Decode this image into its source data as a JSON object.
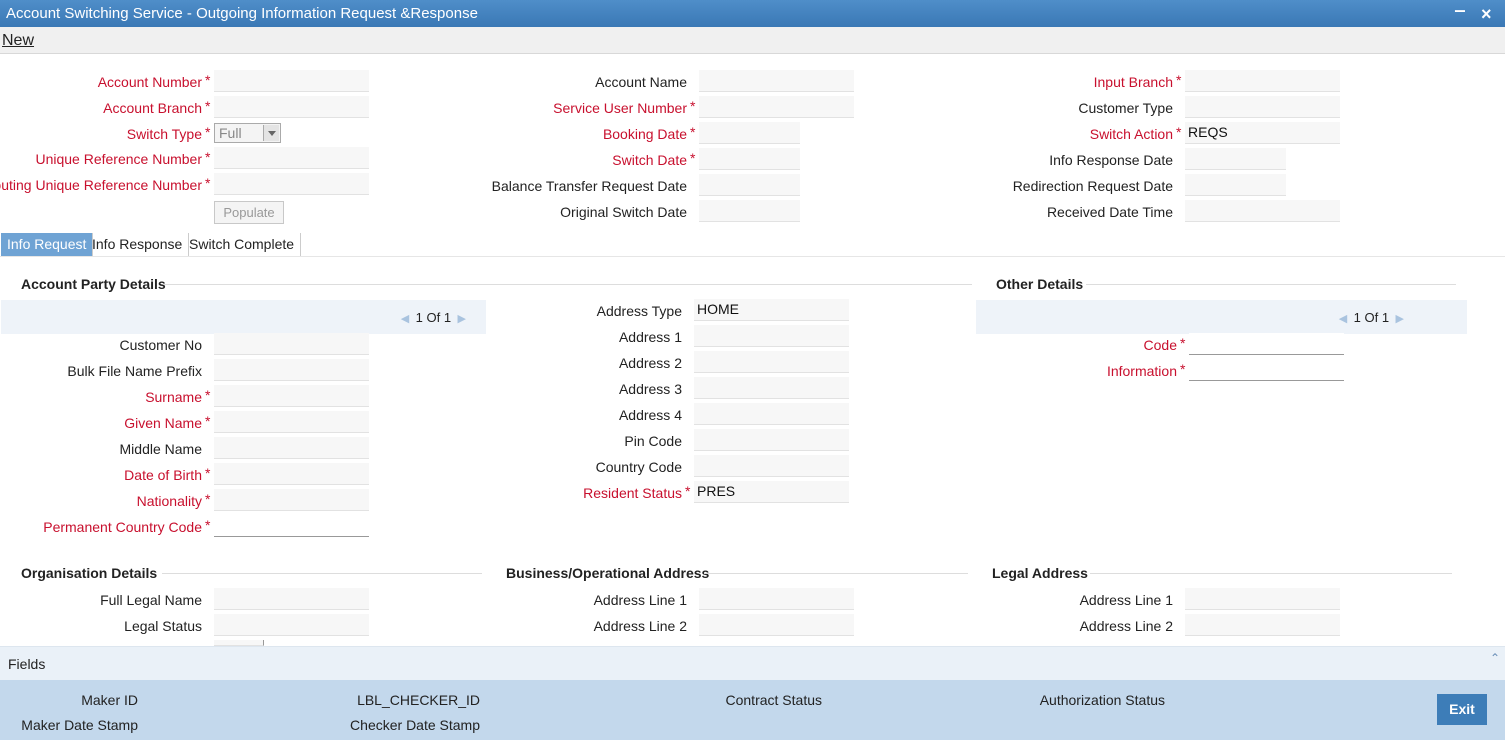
{
  "window": {
    "title": "Account Switching Service - Outgoing Information Request &Response",
    "minimize": "‒",
    "close": "×"
  },
  "menu": {
    "new": "New"
  },
  "header": {
    "col1": {
      "account_number": "Account Number",
      "account_branch": "Account Branch",
      "switch_type": "Switch Type",
      "switch_type_value": "Full",
      "unique_reference_number": "Unique Reference Number",
      "routing_unique_reference_number": "Routing Unique Reference Number",
      "populate": "Populate"
    },
    "col2": {
      "account_name": "Account Name",
      "service_user_number": "Service User Number",
      "booking_date": "Booking Date",
      "switch_date": "Switch Date",
      "balance_transfer_request_date": "Balance Transfer Request Date",
      "original_switch_date": "Original Switch Date"
    },
    "col3": {
      "input_branch": "Input Branch",
      "customer_type": "Customer Type",
      "switch_action": "Switch Action",
      "switch_action_value": "REQS",
      "info_response_date": "Info Response Date",
      "redirection_request_date": "Redirection Request Date",
      "received_date_time": "Received Date Time"
    },
    "required_mark": "*"
  },
  "tabs": [
    "Info Request",
    "Info Response",
    "Switch Complete"
  ],
  "account_party": {
    "heading": "Account Party Details",
    "pager": {
      "current": "1",
      "of": "Of",
      "total": "1"
    },
    "customer_no": "Customer No",
    "bulk_file_name_prefix": "Bulk File Name Prefix",
    "surname": "Surname",
    "given_name": "Given Name",
    "middle_name": "Middle Name",
    "date_of_birth": "Date of Birth",
    "nationality": "Nationality",
    "permanent_country_code": "Permanent Country Code",
    "address_type": "Address Type",
    "address_type_value": "HOME",
    "address_1": "Address 1",
    "address_2": "Address 2",
    "address_3": "Address 3",
    "address_4": "Address 4",
    "pin_code": "Pin Code",
    "country_code": "Country Code",
    "resident_status": "Resident Status",
    "resident_status_value": "PRES"
  },
  "other_details": {
    "heading": "Other Details",
    "pager": {
      "current": "1",
      "of": "Of",
      "total": "1"
    },
    "code": "Code",
    "information": "Information"
  },
  "organisation": {
    "heading": "Organisation Details",
    "full_legal_name": "Full Legal Name",
    "legal_status": "Legal Status"
  },
  "business_address": {
    "heading": "Business/Operational Address",
    "address_line_1": "Address Line 1",
    "address_line_2": "Address Line 2"
  },
  "legal_address": {
    "heading": "Legal Address",
    "address_line_1": "Address Line 1",
    "address_line_2": "Address Line 2"
  },
  "fields_bar": {
    "label": "Fields"
  },
  "footer": {
    "maker_id": "Maker ID",
    "maker_date_stamp": "Maker Date Stamp",
    "checker_id": "LBL_CHECKER_ID",
    "checker_date_stamp": "Checker Date Stamp",
    "contract_status": "Contract Status",
    "authorization_status": "Authorization Status",
    "exit": "Exit"
  },
  "colors": {
    "title_bar": "#3a78b5",
    "required": "#c8102e",
    "footer": "#c3d8ec",
    "exit_button": "#3d7db8",
    "active_tab": "#6fa3d4"
  }
}
